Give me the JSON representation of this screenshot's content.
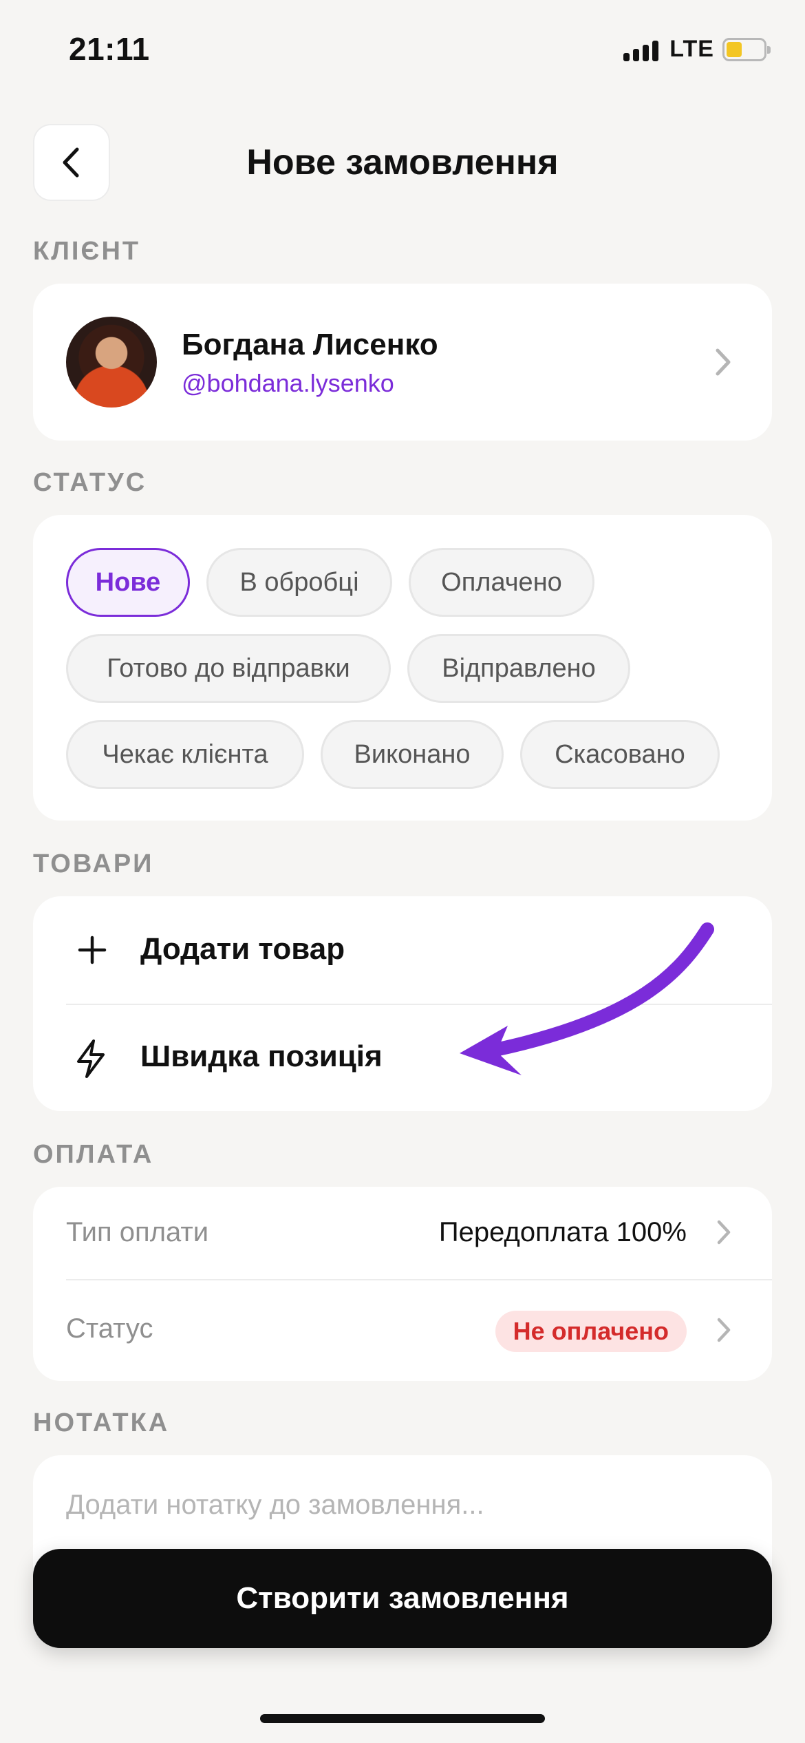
{
  "status_bar": {
    "time": "21:11",
    "network": "LTE",
    "icons": [
      "signal-icon",
      "battery-icon"
    ],
    "battery_color": "#f3c623"
  },
  "header": {
    "title": "Нове замовлення",
    "back_icon": "chevron-left-icon"
  },
  "client": {
    "section_label": "КЛІЄНТ",
    "name": "Богдана Лисенко",
    "handle": "@bohdana.lysenko",
    "chevron_icon": "chevron-right-icon"
  },
  "status": {
    "section_label": "СТАТУС",
    "options": [
      "Нове",
      "В обробці",
      "Оплачено",
      "Готово до відправки",
      "Відправлено",
      "Чекає клієнта",
      "Виконано",
      "Скасовано"
    ],
    "selected": "Нове"
  },
  "items": {
    "section_label": "ТОВАРИ",
    "add_item": "Додати товар",
    "add_icon": "plus-icon",
    "quick_item": "Швидка позиція",
    "quick_icon": "lightning-icon",
    "annotation_icon": "arrow-annotation-icon"
  },
  "payment": {
    "section_label": "ОПЛАТА",
    "type_label": "Тип оплати",
    "type_value": "Передоплата 100%",
    "status_label": "Статус",
    "status_value": "Не оплачено"
  },
  "note": {
    "section_label": "НОТАТКА",
    "placeholder": "Додати нотатку до замовлення..."
  },
  "actions": {
    "create_label": "Створити замовлення"
  },
  "colors": {
    "accent": "#7b2cd9",
    "background": "#f6f5f3",
    "unpaid_text": "#d42b2b",
    "unpaid_bg": "#fde3e3",
    "primary_button": "#0d0d0d"
  }
}
